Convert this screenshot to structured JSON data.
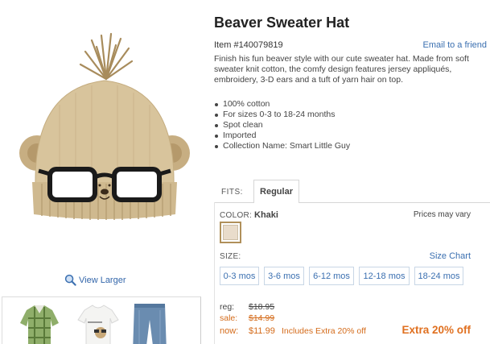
{
  "product": {
    "title": "Beaver Sweater Hat",
    "item_number": "Item #140079819",
    "email_link": "Email to a friend",
    "description": "Finish his fun beaver style with our cute sweater hat. Made from soft sweater knit cotton, the comfy design features jersey appliqués, embroidery, 3-D ears and a tuft of yarn hair on top.",
    "features": [
      "100% cotton",
      "For sizes 0-3 to 18-24 months",
      "Spot clean",
      "Imported",
      "Collection Name: Smart Little Guy"
    ]
  },
  "image": {
    "view_larger": "View Larger",
    "icon": "magnifier-icon"
  },
  "fits": {
    "label": "FITS:",
    "tab": "Regular"
  },
  "color": {
    "label": "COLOR:",
    "value": "Khaki",
    "prices_note": "Prices may vary",
    "swatch_hex": "#e9dccb"
  },
  "size": {
    "label": "SIZE:",
    "chart_link": "Size Chart",
    "options": [
      "0-3 mos",
      "3-6 mos",
      "6-12 mos",
      "12-18 mos",
      "18-24 mos"
    ]
  },
  "pricing": {
    "reg_label": "reg:",
    "reg_value": "$18.95",
    "sale_label": "sale:",
    "sale_value": "$14.99",
    "now_label": "now:",
    "now_value": "$11.99",
    "now_note": "Includes Extra 20% off",
    "promo": "Extra 20% off"
  },
  "colors": {
    "link": "#3a6fb0",
    "sale": "#d46b1a",
    "promo": "#e07020"
  }
}
